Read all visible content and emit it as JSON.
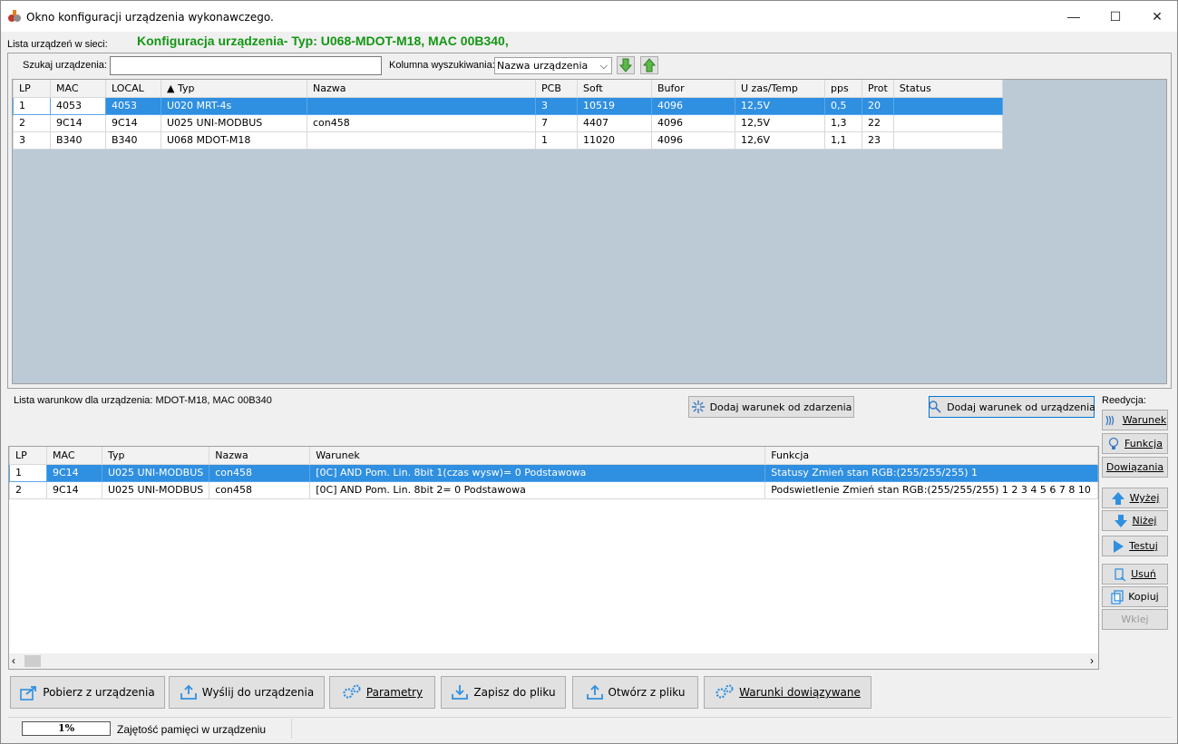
{
  "window": {
    "title": "Okno konfiguracji urządzenia wykonawczego.",
    "minimize": "—",
    "maximize": "☐",
    "close": "✕"
  },
  "header": {
    "device_list_label": "Lista urządzeń w sieci:",
    "config_title": "Konfiguracja urządzenia- Typ: U068-MDOT-M18, MAC 00B340,"
  },
  "search": {
    "label": "Szukaj urządzenia:",
    "value": "",
    "column_label": "Kolumna wyszukiwania:",
    "column_value": "Nazwa urządzenia"
  },
  "devices": {
    "columns": [
      "LP",
      "MAC",
      "LOCAL",
      "▲ Typ",
      "Nazwa",
      "PCB",
      "Soft",
      "Bufor",
      "U zas/Temp",
      "pps",
      "Prot",
      "Status"
    ],
    "rows": [
      [
        "1",
        "4053",
        "4053",
        "U020 MRT-4s",
        "",
        "3",
        "10519",
        "4096",
        "12,5V",
        "0,5",
        "20",
        ""
      ],
      [
        "2",
        "9C14",
        "9C14",
        "U025 UNI-MODBUS",
        "con458",
        "7",
        "4407",
        "4096",
        "12,5V",
        "1,3",
        "22",
        ""
      ],
      [
        "3",
        "B340",
        "B340",
        "U068 MDOT-M18",
        "",
        "1",
        "11020",
        "4096",
        "12,6V",
        "1,1",
        "23",
        ""
      ]
    ],
    "selected_row": 0
  },
  "conditions": {
    "list_label": "Lista warunkow dla urządzenia: MDOT-M18, MAC 00B340",
    "add_event_button": "Dodaj warunek od zdarzenia",
    "add_device_button": "Dodaj warunek od urządzenia",
    "columns": [
      "LP",
      "MAC",
      "Typ",
      "Nazwa",
      "Warunek",
      "Funkcja"
    ],
    "rows": [
      [
        "1",
        "9C14",
        "U025 UNI-MODBUS",
        "con458",
        "[0C] AND  Pom. Lin. 8bit 1(czas wysw)= 0  Podstawowa",
        "Statusy Zmień stan RGB:(255/255/255) 1"
      ],
      [
        "2",
        "9C14",
        "U025 UNI-MODBUS",
        "con458",
        "[0C] AND  Pom. Lin. 8bit 2= 0  Podstawowa",
        "Podswietlenie Zmień stan RGB:(255/255/255) 1 2 3 4 5 6 7 8 10"
      ]
    ],
    "selected_row": 0
  },
  "side": {
    "label": "Reedycja:",
    "warunek": "Warunek",
    "funkcja": "Funkcja",
    "dowiazania": "Dowiązania",
    "wyzej": "Wyżej",
    "nizej": "Niżej",
    "testuj": "Testuj",
    "usun": "Usuń",
    "kopiuj": "Kopiuj",
    "wklej": "Wklej"
  },
  "toolbar": {
    "pobierz": "Pobierz z urządzenia",
    "wyslij": "Wyślij do urządzenia",
    "parametry": "Parametry",
    "zapisz": "Zapisz do pliku",
    "otworz": "Otwórz z pliku",
    "warunki": "Warunki dowiązywane"
  },
  "status": {
    "memory_percent": "1%",
    "memory_label": "Zajętość pamięci w urządzeniu"
  },
  "colors": {
    "accent_green": "#149614",
    "selection_blue": "#2f8fe0",
    "grid_bg": "#bccad6"
  }
}
